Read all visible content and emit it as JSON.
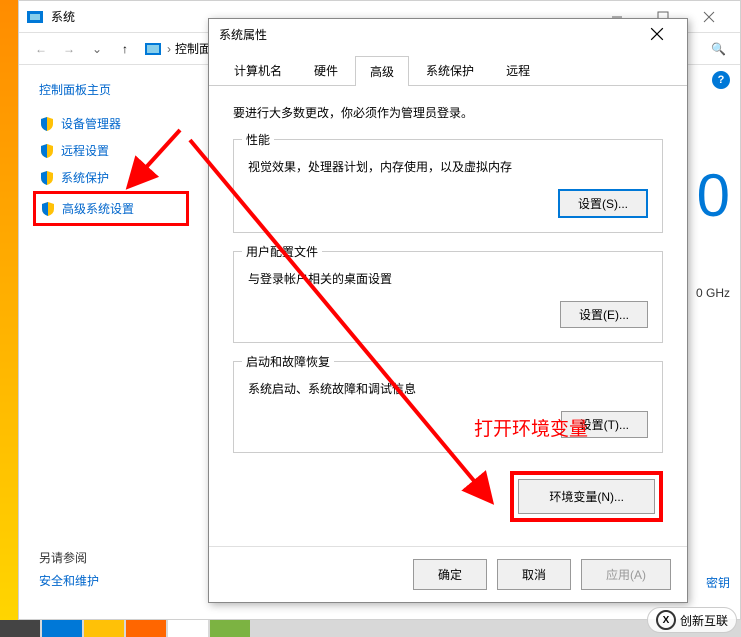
{
  "back_window": {
    "title": "系统",
    "breadcrumb": "控制面板",
    "sidebar": {
      "main": "控制面板主页",
      "items": [
        {
          "label": "设备管理器"
        },
        {
          "label": "远程设置"
        },
        {
          "label": "系统保护"
        },
        {
          "label": "高级系统设置"
        }
      ]
    },
    "see_also": {
      "title": "另请参阅",
      "link": "安全和维护"
    },
    "right_big": "0",
    "right_ghz": "0 GHz",
    "right_key": "密钥"
  },
  "dialog": {
    "title": "系统属性",
    "tabs": [
      {
        "label": "计算机名"
      },
      {
        "label": "硬件"
      },
      {
        "label": "高级",
        "active": true
      },
      {
        "label": "系统保护"
      },
      {
        "label": "远程"
      }
    ],
    "intro": "要进行大多数更改，你必须作为管理员登录。",
    "groups": {
      "perf": {
        "title": "性能",
        "desc": "视觉效果，处理器计划，内存使用，以及虚拟内存",
        "btn": "设置(S)..."
      },
      "profile": {
        "title": "用户配置文件",
        "desc": "与登录帐户相关的桌面设置",
        "btn": "设置(E)..."
      },
      "startup": {
        "title": "启动和故障恢复",
        "desc": "系统启动、系统故障和调试信息",
        "btn": "设置(T)..."
      }
    },
    "env_btn": "环境变量(N)...",
    "footer": {
      "ok": "确定",
      "cancel": "取消",
      "apply": "应用(A)"
    }
  },
  "annotation": "打开环境变量",
  "watermark": {
    "logo": "X",
    "text": "创新互联"
  }
}
